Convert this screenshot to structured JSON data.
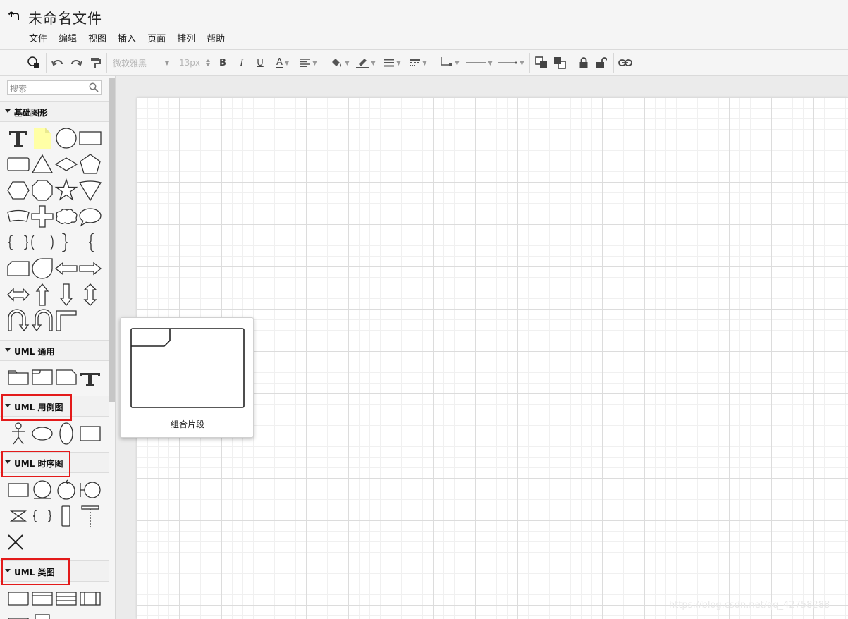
{
  "app": {
    "title": "未命名文件"
  },
  "menu": [
    "文件",
    "编辑",
    "视图",
    "插入",
    "页面",
    "排列",
    "帮助"
  ],
  "toolbar": {
    "font_name": "微软雅黑",
    "font_size": "13px",
    "bold": "B",
    "italic": "I",
    "underline": "U",
    "font_color": "A"
  },
  "sidebar": {
    "search_placeholder": "搜索",
    "sections": [
      {
        "title": "基础图形"
      },
      {
        "title": "UML 通用"
      },
      {
        "title": "UML 用例图"
      },
      {
        "title": "UML 时序图"
      },
      {
        "title": "UML 类图"
      }
    ],
    "highlight_color": "#e31a1a"
  },
  "tooltip": {
    "label": "组合片段"
  },
  "watermark": "https://blog.csdn.net/qq_42758288"
}
